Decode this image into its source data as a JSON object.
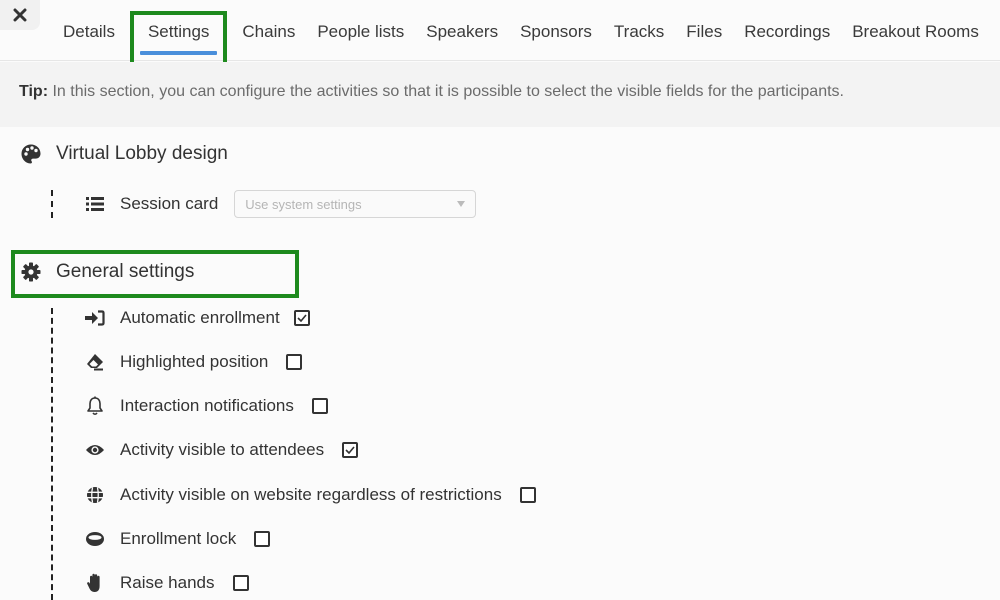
{
  "header": {
    "close_icon": "close-icon",
    "tabs": [
      {
        "label": "Details",
        "active": false
      },
      {
        "label": "Settings",
        "active": true
      },
      {
        "label": "Chains",
        "active": false
      },
      {
        "label": "People lists",
        "active": false
      },
      {
        "label": "Speakers",
        "active": false
      },
      {
        "label": "Sponsors",
        "active": false
      },
      {
        "label": "Tracks",
        "active": false
      },
      {
        "label": "Files",
        "active": false
      },
      {
        "label": "Recordings",
        "active": false
      },
      {
        "label": "Breakout Rooms",
        "active": false
      }
    ]
  },
  "tip": {
    "label": "Tip:",
    "text": " In this section, you can configure the activities so that it is possible to select the visible fields for the participants."
  },
  "virtual_lobby": {
    "title": "Virtual Lobby design",
    "icon": "palette-icon",
    "session_card": {
      "label": "Session card",
      "icon": "list-icon",
      "select_value": "Use system settings"
    }
  },
  "general_settings": {
    "title": "General settings",
    "icon": "gear-icon",
    "items": [
      {
        "label": "Automatic enrollment",
        "icon": "sign-in-icon",
        "checked": true
      },
      {
        "label": "Highlighted position",
        "icon": "eraser-icon",
        "checked": false
      },
      {
        "label": "Interaction notifications",
        "icon": "bell-icon",
        "checked": false
      },
      {
        "label": "Activity visible to attendees",
        "icon": "eye-icon",
        "checked": true
      },
      {
        "label": "Activity visible on website regardless of restrictions",
        "icon": "globe-icon",
        "checked": false
      },
      {
        "label": "Enrollment lock",
        "icon": "ring-icon",
        "checked": false
      },
      {
        "label": "Raise hands",
        "icon": "hand-icon",
        "checked": false
      }
    ]
  },
  "colors": {
    "highlight": "#1e8a1e",
    "active_tab_underline": "#4a8fdb"
  }
}
